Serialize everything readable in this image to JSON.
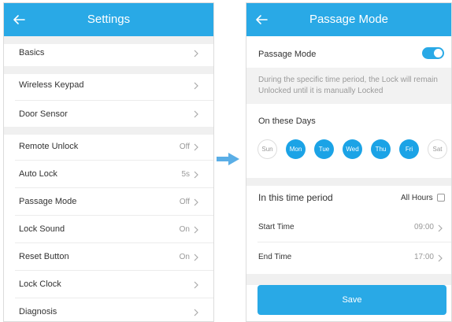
{
  "settings_screen": {
    "title": "Settings",
    "rows": [
      {
        "label": "Basics",
        "value": ""
      },
      {
        "label": "Wireless Keypad",
        "value": ""
      },
      {
        "label": "Door Sensor",
        "value": ""
      },
      {
        "label": "Remote Unlock",
        "value": "Off"
      },
      {
        "label": "Auto Lock",
        "value": "5s"
      },
      {
        "label": "Passage Mode",
        "value": "Off"
      },
      {
        "label": "Lock Sound",
        "value": "On"
      },
      {
        "label": "Reset Button",
        "value": "On"
      },
      {
        "label": "Lock Clock",
        "value": ""
      },
      {
        "label": "Diagnosis",
        "value": ""
      }
    ]
  },
  "passage_screen": {
    "title": "Passage Mode",
    "passage_mode_label": "Passage Mode",
    "passage_mode_enabled": true,
    "description": "During the specific time period, the Lock will remain Unlocked until it is manually Locked",
    "days_label": "On these Days",
    "days": [
      {
        "label": "Sun",
        "selected": false
      },
      {
        "label": "Mon",
        "selected": true
      },
      {
        "label": "Tue",
        "selected": true
      },
      {
        "label": "Wed",
        "selected": true
      },
      {
        "label": "Thu",
        "selected": true
      },
      {
        "label": "Fri",
        "selected": true
      },
      {
        "label": "Sat",
        "selected": false
      }
    ],
    "period_label": "In this time period",
    "all_hours_label": "All Hours",
    "all_hours_checked": false,
    "start_time_label": "Start Time",
    "start_time_value": "09:00",
    "end_time_label": "End Time",
    "end_time_value": "17:00",
    "save_label": "Save"
  },
  "colors": {
    "accent": "#29a9e6",
    "day_selected": "#1ba3e6",
    "separator": "#f0f0f0"
  }
}
